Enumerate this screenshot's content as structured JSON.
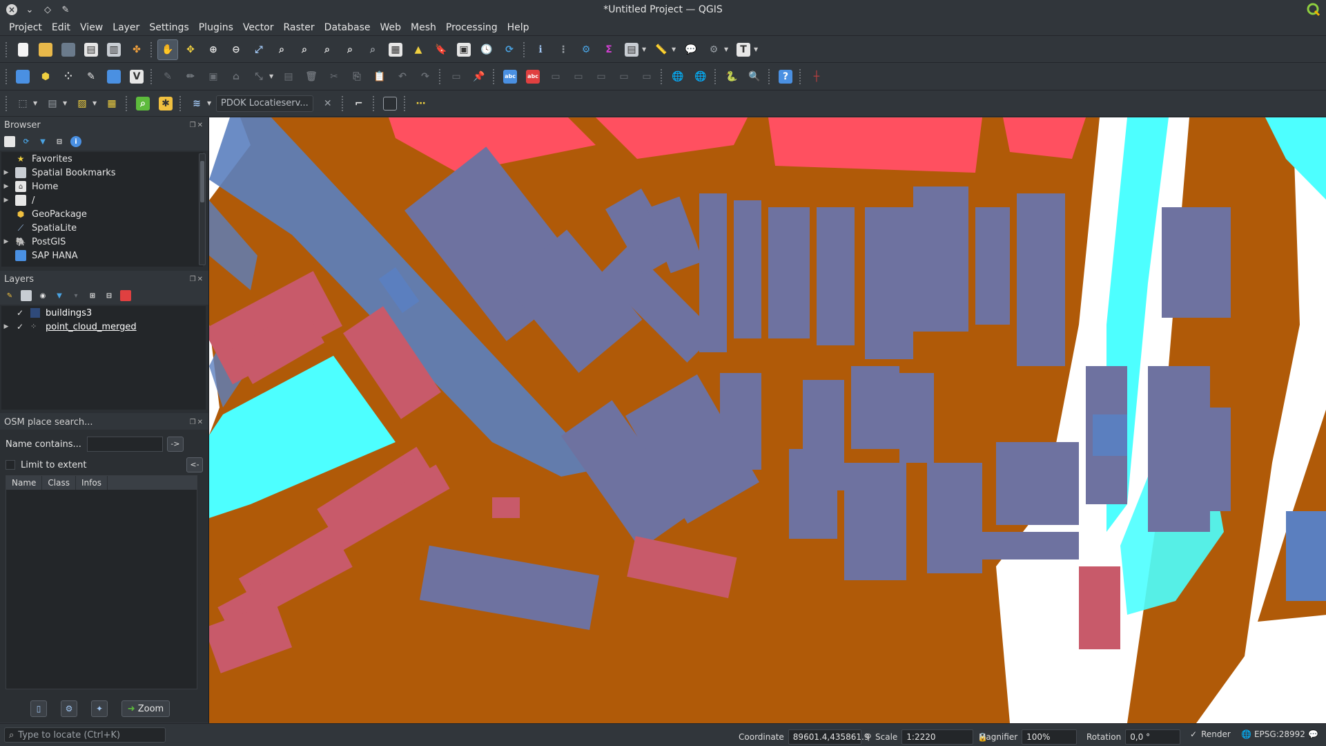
{
  "window": {
    "title": "*Untitled Project — QGIS"
  },
  "menu": [
    "Project",
    "Edit",
    "View",
    "Layer",
    "Settings",
    "Plugins",
    "Vector",
    "Raster",
    "Database",
    "Web",
    "Mesh",
    "Processing",
    "Help"
  ],
  "toolbar3": {
    "locator_service": "PDOK Locatieserv..."
  },
  "browser": {
    "title": "Browser",
    "items": [
      {
        "label": "Favorites",
        "icon": "star-icon",
        "expandable": false
      },
      {
        "label": "Spatial Bookmarks",
        "icon": "bookmark-icon",
        "expandable": true
      },
      {
        "label": "Home",
        "icon": "home-folder-icon",
        "expandable": true
      },
      {
        "label": "/",
        "icon": "folder-icon",
        "expandable": true
      },
      {
        "label": "GeoPackage",
        "icon": "geopackage-icon",
        "expandable": false
      },
      {
        "label": "SpatiaLite",
        "icon": "spatialite-icon",
        "expandable": false
      },
      {
        "label": "PostGIS",
        "icon": "postgis-icon",
        "expandable": true
      },
      {
        "label": "SAP HANA",
        "icon": "sap-hana-icon",
        "expandable": false
      }
    ]
  },
  "layers": {
    "title": "Layers",
    "items": [
      {
        "label": "buildings3",
        "checked": true,
        "symbol_color": "#2f4a7a",
        "expandable": false
      },
      {
        "label": "point_cloud_merged",
        "checked": true,
        "symbol_color": "#cccccc",
        "expandable": true
      }
    ]
  },
  "osm": {
    "title": "OSM place search...",
    "name_label": "Name contains...",
    "name_value": "",
    "go_button": "->",
    "limit_label": "Limit to extent",
    "limit_button": "<-",
    "columns": [
      "Name",
      "Class",
      "Infos"
    ],
    "zoom_button": "Zoom"
  },
  "status": {
    "locate_placeholder": "Type to locate (Ctrl+K)",
    "coordinate_label": "Coordinate",
    "coordinate_value": "89601.4,435861.9",
    "scale_label": "Scale",
    "scale_value": "1:2220",
    "magnifier_label": "Magnifier",
    "magnifier_value": "100%",
    "rotation_label": "Rotation",
    "rotation_value": "0,0 °",
    "render_label": "Render",
    "crs": "EPSG:28992"
  },
  "map_colors": {
    "ground": "#b05a08",
    "building": "#6e72a0",
    "building_red": "#c85a6a",
    "roof_red": "#ff5060",
    "water": "#4dffff",
    "blue_poly": "#5b7fbf",
    "white": "#ffffff"
  }
}
